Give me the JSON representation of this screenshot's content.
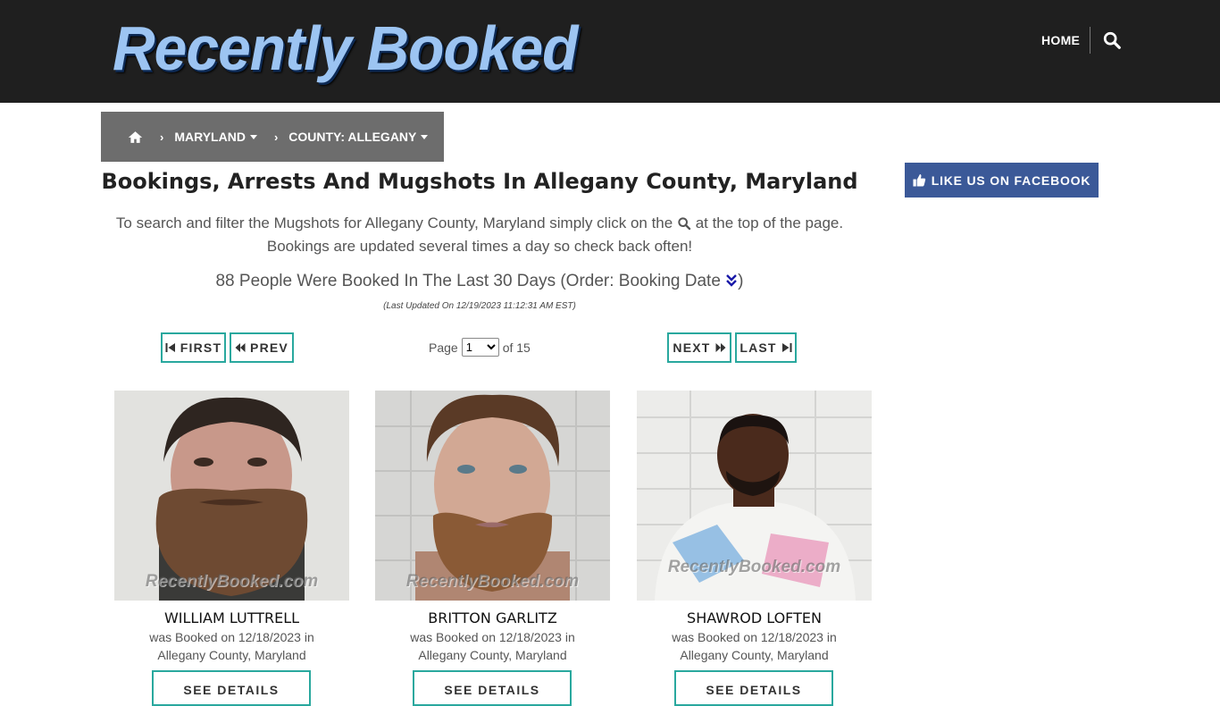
{
  "header": {
    "logo_text": "Recently Booked",
    "nav_home": "HOME",
    "search_icon": "search-icon"
  },
  "breadcrumb": {
    "home_icon": "home-icon",
    "state": "MARYLAND",
    "county": "COUNTY: ALLEGANY"
  },
  "main": {
    "title": "Bookings, Arrests And Mugshots In Allegany County, Maryland",
    "intro_before": "To search and filter the Mugshots for Allegany County, Maryland simply click on the",
    "intro_after": "at the top of the page.",
    "intro_line2": "Bookings are updated several times a day so check back often!",
    "count_text": "88 People Were Booked In The Last 30 Days (Order: Booking Date",
    "count_close": ")",
    "last_updated": "(Last Updated On 12/19/2023 11:12:31 AM EST)"
  },
  "pagination": {
    "first": "FIRST",
    "prev": "PREV",
    "page_label": "Page",
    "current_page": "1",
    "of_label": "of 15",
    "next": "NEXT",
    "last": "LAST"
  },
  "sidebar": {
    "facebook_label": "LIKE US ON FACEBOOK"
  },
  "watermark": "RecentlyBooked.com",
  "bookings": [
    {
      "name": "WILLIAM LUTTRELL",
      "line1": "was Booked on 12/18/2023 in",
      "line2": "Allegany County, Maryland",
      "button": "SEE DETAILS"
    },
    {
      "name": "BRITTON GARLITZ",
      "line1": "was Booked on 12/18/2023 in",
      "line2": "Allegany County, Maryland",
      "button": "SEE DETAILS"
    },
    {
      "name": "SHAWROD LOFTEN",
      "line1": "was Booked on 12/18/2023 in",
      "line2": "Allegany County, Maryland",
      "button": "SEE DETAILS"
    }
  ],
  "colors": {
    "header_bg": "#1f1f1f",
    "breadcrumb_bg": "#6d6d6d",
    "accent_teal": "#29a89e",
    "facebook_blue": "#3b5998"
  }
}
